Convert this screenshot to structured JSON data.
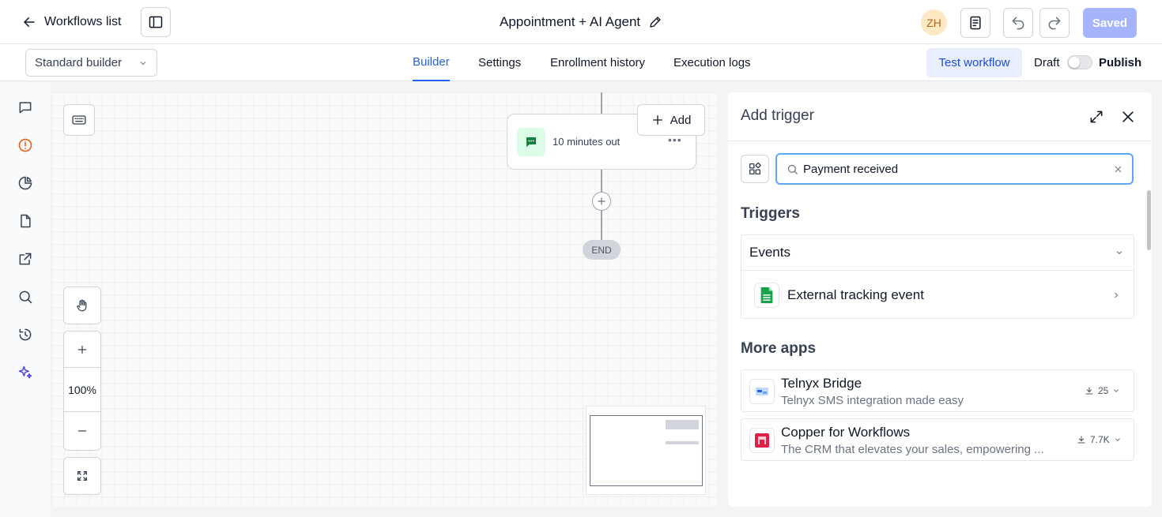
{
  "header": {
    "back_label": "Workflows list",
    "workflow_title": "Appointment + AI Agent",
    "avatar_initials": "ZH",
    "saved_label": "Saved"
  },
  "subbar": {
    "builder_mode": "Standard builder",
    "tabs": [
      {
        "label": "Builder",
        "active": true
      },
      {
        "label": "Settings",
        "active": false
      },
      {
        "label": "Enrollment history",
        "active": false
      },
      {
        "label": "Execution logs",
        "active": false
      }
    ],
    "test_label": "Test workflow",
    "draft_label": "Draft",
    "publish_label": "Publish",
    "published": false
  },
  "rail": {
    "icons": [
      "chat-icon",
      "alert-circle-icon",
      "pie-chart-icon",
      "file-icon",
      "external-link-icon",
      "search-icon",
      "history-icon",
      "sparkle-icon"
    ]
  },
  "canvas": {
    "node_label": "10 minutes out",
    "add_label": "Add",
    "end_label": "END",
    "zoom_level": "100%"
  },
  "panel": {
    "title": "Add trigger",
    "search_value": "Payment received",
    "triggers_heading": "Triggers",
    "events_label": "Events",
    "event_item": "External tracking event",
    "more_apps_heading": "More apps",
    "apps": [
      {
        "name": "Telnyx Bridge",
        "description": "Telnyx SMS integration made easy",
        "installs": "25"
      },
      {
        "name": "Copper for Workflows",
        "description": "The CRM that elevates your sales, empowering ...",
        "installs": "7.7K"
      }
    ]
  },
  "colors": {
    "accent": "#2563eb",
    "saved_bg": "#a5b4fc",
    "search_border": "#60a5fa",
    "sparkle": "#4f46e5",
    "alert": "#ea580c"
  }
}
